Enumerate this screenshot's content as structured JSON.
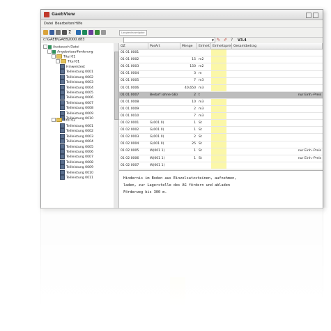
{
  "window": {
    "title": "GaebView"
  },
  "menu": [
    "Datei",
    "Bearbeiten",
    "Hilfe"
  ],
  "toolbar": {
    "filter_text": "Langtextanzeigabe"
  },
  "address": "c:\\GAEB\\GAEB2000.d83",
  "category_select": "",
  "tree": {
    "root": "Austausch Datei",
    "level1": "Angebotsaufforderung",
    "titel1": "Titel 01",
    "titel1_sub": "Titel 01",
    "items_a": [
      "Hinweistext",
      "Teilleistung 0001",
      "Teilleistung 0002",
      "Teilleistung 0003",
      "Teilleistung 0004",
      "Teilleistung 0005",
      "Teilleistung 0006",
      "Teilleistung 0007",
      "Teilleistung 0008",
      "Teilleistung 0009",
      "Teilleistung 0010"
    ],
    "titel2": "Titel 02",
    "items_b": [
      "Teilleistung 0001",
      "Teilleistung 0002",
      "Teilleistung 0003",
      "Teilleistung 0004",
      "Teilleistung 0005",
      "Teilleistung 0006",
      "Teilleistung 0007",
      "Teilleistung 0008",
      "Teilleistung 0009",
      "Teilleistung 0010",
      "Teilleistung 0011"
    ]
  },
  "grid": {
    "headers": [
      "OZ",
      "PosArt",
      "Menge",
      "Einheit",
      "Einheitspreis",
      "Gesamtbetrag"
    ],
    "rows": [
      {
        "oz": "01 01 0001",
        "posart": "",
        "menge": "",
        "einheit": "",
        "ges": ""
      },
      {
        "oz": "01 01 0002",
        "posart": "",
        "menge": "15",
        "einheit": "m2",
        "ges": ""
      },
      {
        "oz": "01 01 0003",
        "posart": "",
        "menge": "150",
        "einheit": "m2",
        "ges": ""
      },
      {
        "oz": "01 01 0004",
        "posart": "",
        "menge": "3",
        "einheit": "m",
        "ges": ""
      },
      {
        "oz": "01 01 0005",
        "posart": "",
        "menge": "7",
        "einheit": "m3",
        "ges": ""
      },
      {
        "oz": "01 01 0006",
        "posart": "",
        "menge": "40,650",
        "einheit": "m3",
        "ges": ""
      },
      {
        "oz": "01 01 0007",
        "posart": "Bedarf (ohne GB)",
        "menge": "2",
        "einheit": "t",
        "ges": "nur Einh.-Preis"
      },
      {
        "oz": "01 01 0008",
        "posart": "",
        "menge": "10",
        "einheit": "m3",
        "ges": ""
      },
      {
        "oz": "01 01 0009",
        "posart": "",
        "menge": "2",
        "einheit": "m3",
        "ges": ""
      },
      {
        "oz": "01 01 0010",
        "posart": "",
        "menge": "7",
        "einheit": "m3",
        "ges": ""
      },
      {
        "oz": "01 02 0001",
        "posart": "G(001 0)",
        "menge": "1",
        "einheit": "St",
        "ges": ""
      },
      {
        "oz": "01 02 0002",
        "posart": "G(001 0)",
        "menge": "1",
        "einheit": "St",
        "ges": ""
      },
      {
        "oz": "01 02 0003",
        "posart": "G(001 0)",
        "menge": "2",
        "einheit": "St",
        "ges": ""
      },
      {
        "oz": "01 02 0004",
        "posart": "G(001 0)",
        "menge": "25",
        "einheit": "St",
        "ges": ""
      },
      {
        "oz": "01 02 0005",
        "posart": "W(001 1)",
        "menge": "1",
        "einheit": "St",
        "ges": "nur Einh.-Preis"
      },
      {
        "oz": "01 02 0006",
        "posart": "W(001 1)",
        "menge": "1",
        "einheit": "St",
        "ges": "nur Einh.-Preis"
      },
      {
        "oz": "01 02 0007",
        "posart": "W(001 1)",
        "menge": "",
        "einheit": "",
        "ges": ""
      }
    ],
    "selected_row": 6
  },
  "detail": {
    "lines": [
      "Hindernis im Boden aus Einzelsatzsteinen, aufnehmen,",
      "laden, zur Lagerstelle des AG fördern und abladen",
      "Förderweg bis 300 m."
    ]
  },
  "colors": {
    "yellow_column": "#fbf7a8",
    "selection": "#bdbdbd"
  }
}
